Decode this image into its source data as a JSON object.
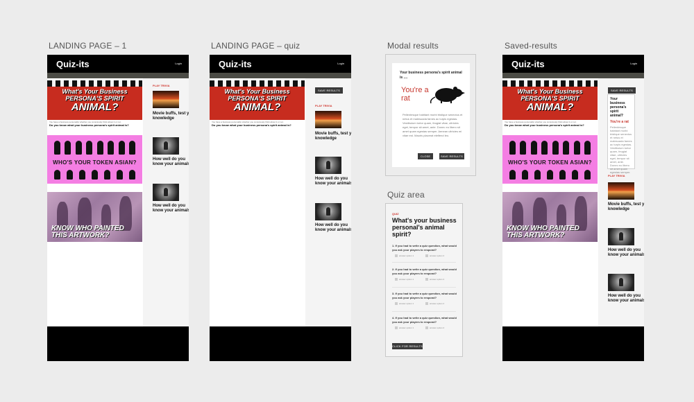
{
  "frames": {
    "landing1": {
      "title": "LANDING PAGE – 1"
    },
    "landingQuiz": {
      "title": "LANDING PAGE – quiz"
    },
    "modal": {
      "title": "Modal results"
    },
    "quiz": {
      "title": "Quiz area"
    },
    "saved": {
      "title": "Saved-results"
    }
  },
  "header": {
    "logo": "Quiz-its",
    "login": "Login"
  },
  "banners": {
    "persona": {
      "line1": "What's Your Business",
      "line2": "PERSONA'S SPIRIT",
      "line3": "ANIMAL?",
      "foot1": "You have a business personality whether you consciously think about it or not.",
      "foot2": "Do you know what your business persona's spirit animal is?"
    },
    "asian": {
      "title": "WHO'S YOUR TOKEN ASIAN?"
    },
    "art": {
      "line1": "KNOW WHO PAINTED",
      "line2": "THIS ARTWORK?"
    }
  },
  "sidebar": {
    "label": "PLAY TRIVIA",
    "items": [
      {
        "caption": "Movie buffs, test you knowledge"
      },
      {
        "caption": "How well do you know your animals?"
      },
      {
        "caption": "How well do you know your animals?"
      }
    ]
  },
  "buttons": {
    "save_results": "SAVE RESULTS",
    "close": "CLOSE",
    "click_for_results": "CLICK FOR RESULTS"
  },
  "modal": {
    "question": "Your business persona's spirit animal is ....",
    "answer": "You're a rat",
    "paragraph": "Pellentesque habitant morbi tristique senectus et netus et malesuada fames ac turpis egestas. Vestibulum tortor quam, feugiat vitae, ultricies eget, tempor sit amet, ante. Donec eu libero sit amet quam egestas semper. Aenean ultricies mi vitae est. Mauris placerat eleifend leo."
  },
  "saved_card": {
    "question": "Your business persona's spirit animal?",
    "answer": "You're a rat",
    "paragraph": "Pellentesque habitant morbi tristique senectus et netus et malesuada fames ac turpis egestas. Vestibulum tortor quam, feugiat vitae, ultricies eget, tempor sit amet, ante. Donec eu libero sit amet quam egestas semper. Aenean ultricies mi vitae est."
  },
  "quiz": {
    "kicker": "QUIZ",
    "title": "What's your business personal's animal spirit?",
    "questions": [
      {
        "text": "1. If you had to write a quiz question, what would you ask your players to respond?",
        "opt_a": "answer option 1",
        "opt_b": "answer option 2"
      },
      {
        "text": "2. If you had to write a quiz question, what would you ask your players to respond?",
        "opt_a": "answer option 1",
        "opt_b": "answer option 2"
      },
      {
        "text": "3. If you had to write a quiz question, what would you ask your players to respond?",
        "opt_a": "answer option 1",
        "opt_b": "answer option 2"
      },
      {
        "text": "4. If you had to write a quiz question, what would you ask your players to respond?",
        "opt_a": "answer option 1",
        "opt_b": "answer option 2"
      }
    ]
  },
  "colors": {
    "accent": "#c6342b",
    "header": "#000000",
    "strip": "#4b4b45",
    "pink": "#f47ee3",
    "red_banner": "#c72c1f"
  }
}
